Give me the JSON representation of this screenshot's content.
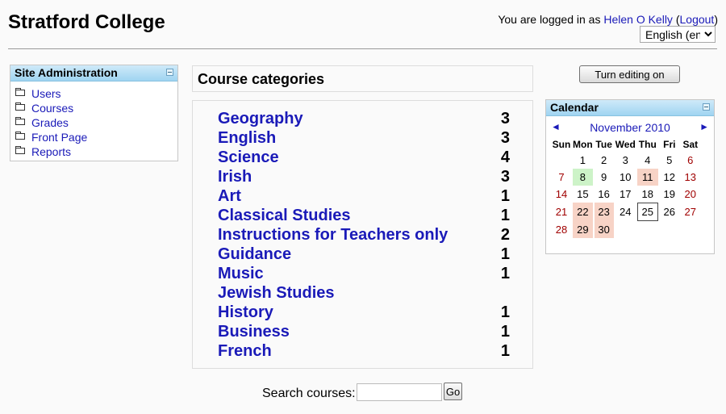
{
  "header": {
    "site_title": "Stratford College",
    "logged_in_prefix": "You are logged in as ",
    "user_name": "Helen O Kelly",
    "logout_open": " (",
    "logout_label": "Logout",
    "logout_close": ")",
    "language": "English (en)"
  },
  "admin": {
    "title": "Site Administration",
    "items": [
      "Users",
      "Courses",
      "Grades",
      "Front Page",
      "Reports"
    ]
  },
  "categories": {
    "title": "Course categories",
    "items": [
      {
        "name": "Geography",
        "count": "3"
      },
      {
        "name": "English",
        "count": "3"
      },
      {
        "name": "Science",
        "count": "4"
      },
      {
        "name": "Irish",
        "count": "3"
      },
      {
        "name": "Art",
        "count": "1"
      },
      {
        "name": "Classical Studies",
        "count": "1"
      },
      {
        "name": "Instructions for Teachers only",
        "count": "2"
      },
      {
        "name": "Guidance",
        "count": "1"
      },
      {
        "name": "Music",
        "count": "1"
      },
      {
        "name": "Jewish Studies",
        "count": ""
      },
      {
        "name": "History",
        "count": "1"
      },
      {
        "name": "Business",
        "count": "1"
      },
      {
        "name": "French",
        "count": "1"
      }
    ]
  },
  "search": {
    "label": "Search courses:",
    "go_label": "Go",
    "value": ""
  },
  "editing": {
    "button_label": "Turn editing on"
  },
  "calendar": {
    "title": "Calendar",
    "prev": "◄",
    "next": "►",
    "month": "November 2010",
    "weekdays": [
      "Sun",
      "Mon",
      "Tue",
      "Wed",
      "Thu",
      "Fri",
      "Sat"
    ],
    "weeks": [
      [
        "",
        "1",
        "2",
        "3",
        "4",
        "5",
        "6"
      ],
      [
        "7",
        "8",
        "9",
        "10",
        "11",
        "12",
        "13"
      ],
      [
        "14",
        "15",
        "16",
        "17",
        "18",
        "19",
        "20"
      ],
      [
        "21",
        "22",
        "23",
        "24",
        "25",
        "26",
        "27"
      ],
      [
        "28",
        "29",
        "30",
        "",
        "",
        "",
        ""
      ]
    ],
    "event_days": [
      "11",
      "22",
      "23",
      "29",
      "30"
    ],
    "green_days": [
      "8"
    ],
    "today": "25",
    "colors": {
      "event": "#f7d3c6",
      "green_event": "#cdf3c8",
      "weekend": "#a00000"
    }
  }
}
